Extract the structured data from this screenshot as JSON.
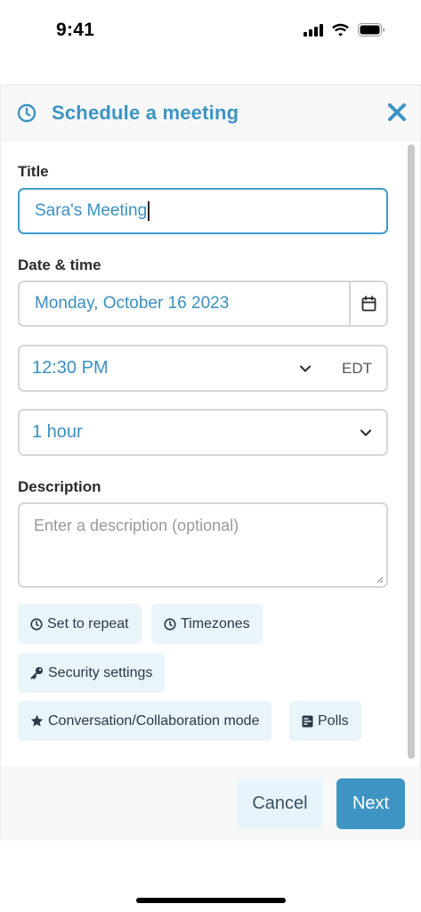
{
  "status_bar": {
    "time": "9:41"
  },
  "dialog": {
    "title": "Schedule a meeting",
    "title_icon": "clock-icon",
    "close_icon": "close-icon",
    "accent_color": "#3c94c4"
  },
  "form": {
    "title_label": "Title",
    "title_value": "Sara's Meeting",
    "datetime_label": "Date & time",
    "date_value": "Monday, October 16 2023",
    "time_value": "12:30 PM",
    "timezone": "EDT",
    "duration_value": "1 hour",
    "description_label": "Description",
    "description_placeholder": "Enter a description (optional)"
  },
  "options": [
    {
      "label": "Set to repeat",
      "icon": "clock-icon"
    },
    {
      "label": "Timezones",
      "icon": "clock-icon"
    },
    {
      "label": "Security settings",
      "icon": "key-icon"
    },
    {
      "label": "Conversation/Collaboration mode",
      "icon": "star-icon"
    },
    {
      "label": "Polls",
      "icon": "poll-icon"
    }
  ],
  "footer": {
    "cancel_label": "Cancel",
    "next_label": "Next"
  }
}
